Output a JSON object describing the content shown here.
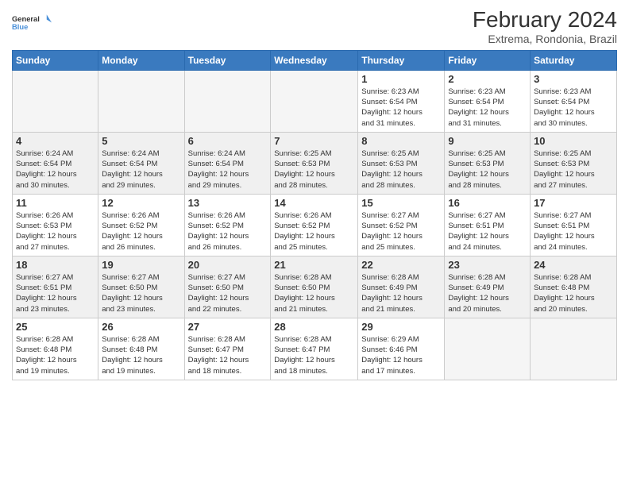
{
  "logo": {
    "line1": "General",
    "line2": "Blue"
  },
  "title": "February 2024",
  "subtitle": "Extrema, Rondonia, Brazil",
  "days_of_week": [
    "Sunday",
    "Monday",
    "Tuesday",
    "Wednesday",
    "Thursday",
    "Friday",
    "Saturday"
  ],
  "weeks": [
    [
      {
        "day": "",
        "info": ""
      },
      {
        "day": "",
        "info": ""
      },
      {
        "day": "",
        "info": ""
      },
      {
        "day": "",
        "info": ""
      },
      {
        "day": "1",
        "info": "Sunrise: 6:23 AM\nSunset: 6:54 PM\nDaylight: 12 hours\nand 31 minutes."
      },
      {
        "day": "2",
        "info": "Sunrise: 6:23 AM\nSunset: 6:54 PM\nDaylight: 12 hours\nand 31 minutes."
      },
      {
        "day": "3",
        "info": "Sunrise: 6:23 AM\nSunset: 6:54 PM\nDaylight: 12 hours\nand 30 minutes."
      }
    ],
    [
      {
        "day": "4",
        "info": "Sunrise: 6:24 AM\nSunset: 6:54 PM\nDaylight: 12 hours\nand 30 minutes."
      },
      {
        "day": "5",
        "info": "Sunrise: 6:24 AM\nSunset: 6:54 PM\nDaylight: 12 hours\nand 29 minutes."
      },
      {
        "day": "6",
        "info": "Sunrise: 6:24 AM\nSunset: 6:54 PM\nDaylight: 12 hours\nand 29 minutes."
      },
      {
        "day": "7",
        "info": "Sunrise: 6:25 AM\nSunset: 6:53 PM\nDaylight: 12 hours\nand 28 minutes."
      },
      {
        "day": "8",
        "info": "Sunrise: 6:25 AM\nSunset: 6:53 PM\nDaylight: 12 hours\nand 28 minutes."
      },
      {
        "day": "9",
        "info": "Sunrise: 6:25 AM\nSunset: 6:53 PM\nDaylight: 12 hours\nand 28 minutes."
      },
      {
        "day": "10",
        "info": "Sunrise: 6:25 AM\nSunset: 6:53 PM\nDaylight: 12 hours\nand 27 minutes."
      }
    ],
    [
      {
        "day": "11",
        "info": "Sunrise: 6:26 AM\nSunset: 6:53 PM\nDaylight: 12 hours\nand 27 minutes."
      },
      {
        "day": "12",
        "info": "Sunrise: 6:26 AM\nSunset: 6:52 PM\nDaylight: 12 hours\nand 26 minutes."
      },
      {
        "day": "13",
        "info": "Sunrise: 6:26 AM\nSunset: 6:52 PM\nDaylight: 12 hours\nand 26 minutes."
      },
      {
        "day": "14",
        "info": "Sunrise: 6:26 AM\nSunset: 6:52 PM\nDaylight: 12 hours\nand 25 minutes."
      },
      {
        "day": "15",
        "info": "Sunrise: 6:27 AM\nSunset: 6:52 PM\nDaylight: 12 hours\nand 25 minutes."
      },
      {
        "day": "16",
        "info": "Sunrise: 6:27 AM\nSunset: 6:51 PM\nDaylight: 12 hours\nand 24 minutes."
      },
      {
        "day": "17",
        "info": "Sunrise: 6:27 AM\nSunset: 6:51 PM\nDaylight: 12 hours\nand 24 minutes."
      }
    ],
    [
      {
        "day": "18",
        "info": "Sunrise: 6:27 AM\nSunset: 6:51 PM\nDaylight: 12 hours\nand 23 minutes."
      },
      {
        "day": "19",
        "info": "Sunrise: 6:27 AM\nSunset: 6:50 PM\nDaylight: 12 hours\nand 23 minutes."
      },
      {
        "day": "20",
        "info": "Sunrise: 6:27 AM\nSunset: 6:50 PM\nDaylight: 12 hours\nand 22 minutes."
      },
      {
        "day": "21",
        "info": "Sunrise: 6:28 AM\nSunset: 6:50 PM\nDaylight: 12 hours\nand 21 minutes."
      },
      {
        "day": "22",
        "info": "Sunrise: 6:28 AM\nSunset: 6:49 PM\nDaylight: 12 hours\nand 21 minutes."
      },
      {
        "day": "23",
        "info": "Sunrise: 6:28 AM\nSunset: 6:49 PM\nDaylight: 12 hours\nand 20 minutes."
      },
      {
        "day": "24",
        "info": "Sunrise: 6:28 AM\nSunset: 6:48 PM\nDaylight: 12 hours\nand 20 minutes."
      }
    ],
    [
      {
        "day": "25",
        "info": "Sunrise: 6:28 AM\nSunset: 6:48 PM\nDaylight: 12 hours\nand 19 minutes."
      },
      {
        "day": "26",
        "info": "Sunrise: 6:28 AM\nSunset: 6:48 PM\nDaylight: 12 hours\nand 19 minutes."
      },
      {
        "day": "27",
        "info": "Sunrise: 6:28 AM\nSunset: 6:47 PM\nDaylight: 12 hours\nand 18 minutes."
      },
      {
        "day": "28",
        "info": "Sunrise: 6:28 AM\nSunset: 6:47 PM\nDaylight: 12 hours\nand 18 minutes."
      },
      {
        "day": "29",
        "info": "Sunrise: 6:29 AM\nSunset: 6:46 PM\nDaylight: 12 hours\nand 17 minutes."
      },
      {
        "day": "",
        "info": ""
      },
      {
        "day": "",
        "info": ""
      }
    ]
  ]
}
